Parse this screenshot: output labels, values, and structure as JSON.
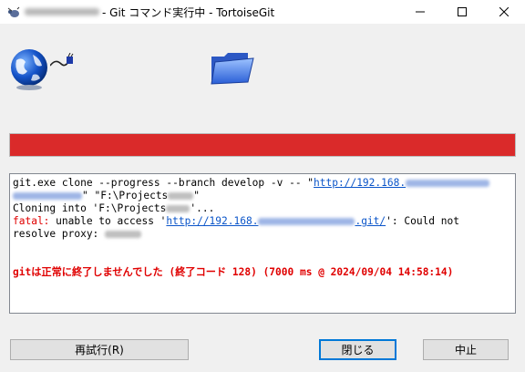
{
  "window": {
    "title": "- Git コマンド実行中 - TortoiseGit"
  },
  "log": {
    "line1_prefix": "git.exe clone --progress --branch develop -v -- \"",
    "line1_link": "http://192.168.",
    "line2_suffix": "\" \"F:\\Projects",
    "line2_end": "\"",
    "line3": "Cloning into 'F:\\Projects",
    "line3_end": "'...",
    "fatal_label": "fatal:",
    "line4_middle": " unable to access '",
    "line4_link_start": "http://192.168.",
    "line4_link_end": ".git/",
    "line4_end": "': Could not",
    "line5": "resolve proxy: ",
    "error_message": "gitは正常に終了しませんでした (終了コード 128) (7000 ms @ 2024/09/04 14:58:14)"
  },
  "progress": {
    "fraction": 1.0,
    "color": "#da2a2a"
  },
  "buttons": {
    "retry": "再試行(R)",
    "close": "閉じる",
    "abort": "中止"
  },
  "icons": {
    "app": "tortoisegit-icon",
    "source": "globe-icon",
    "dest": "folder-icon"
  }
}
